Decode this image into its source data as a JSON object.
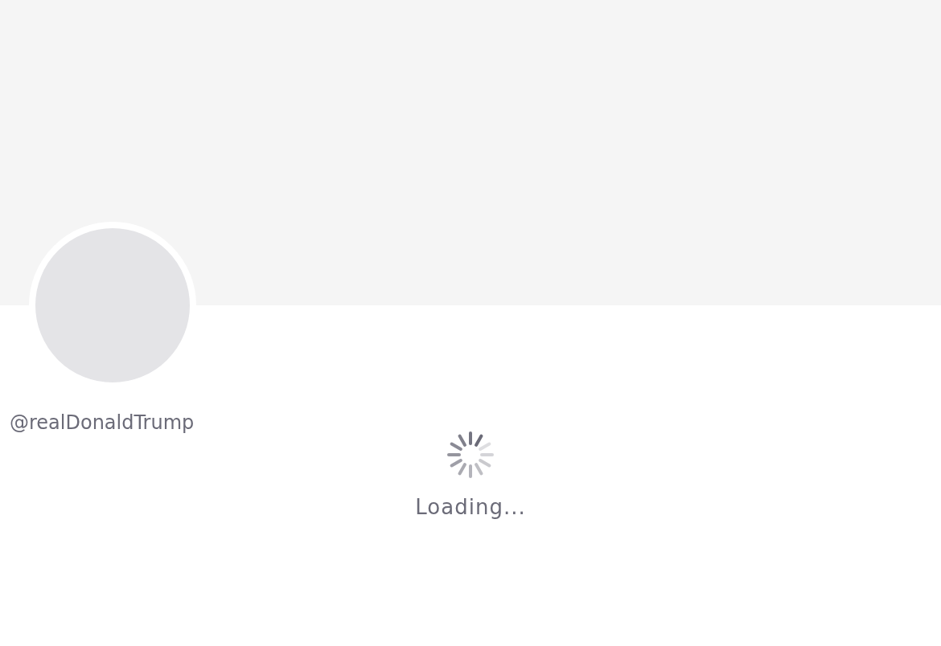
{
  "profile": {
    "handle": "@realDonaldTrump"
  },
  "status": {
    "message": "Loading..."
  }
}
